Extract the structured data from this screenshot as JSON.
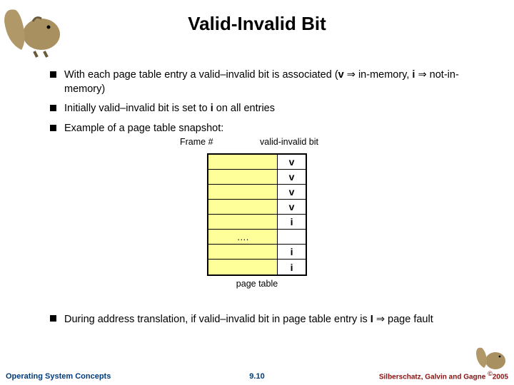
{
  "title": "Valid-Invalid Bit",
  "bullets": {
    "b1_a": "With each page table entry a valid–invalid bit is associated (",
    "b1_v": "v",
    "b1_b": " in-memory, ",
    "b1_i": "i",
    "b1_c": " not-in-memory)",
    "b2_a": "Initially valid–invalid bit is set to ",
    "b2_i": "i",
    "b2_b": " on all entries",
    "b3": "Example of a page table snapshot:"
  },
  "labels": {
    "frame": "Frame #",
    "vib": "valid-invalid bit",
    "caption": "page table",
    "ellipsis": "…."
  },
  "rows": {
    "r0": "v",
    "r1": "v",
    "r2": "v",
    "r3": "v",
    "r4": "i",
    "r6": "i",
    "r7": "i"
  },
  "lower": {
    "a": "During address translation, if valid–invalid bit in page table entry is ",
    "I": "I",
    "b": " page fault"
  },
  "footer": {
    "left": "Operating System Concepts",
    "center": "9.10",
    "right_a": "Silberschatz, Galvin and Gagne ",
    "right_b": "2005"
  },
  "chart_data": {
    "type": "table",
    "title": "page table",
    "columns": [
      "Frame #",
      "valid-invalid bit"
    ],
    "rows": [
      [
        "",
        "v"
      ],
      [
        "",
        "v"
      ],
      [
        "",
        "v"
      ],
      [
        "",
        "v"
      ],
      [
        "",
        "i"
      ],
      [
        "….",
        ""
      ],
      [
        "",
        "i"
      ],
      [
        "",
        "i"
      ]
    ]
  }
}
